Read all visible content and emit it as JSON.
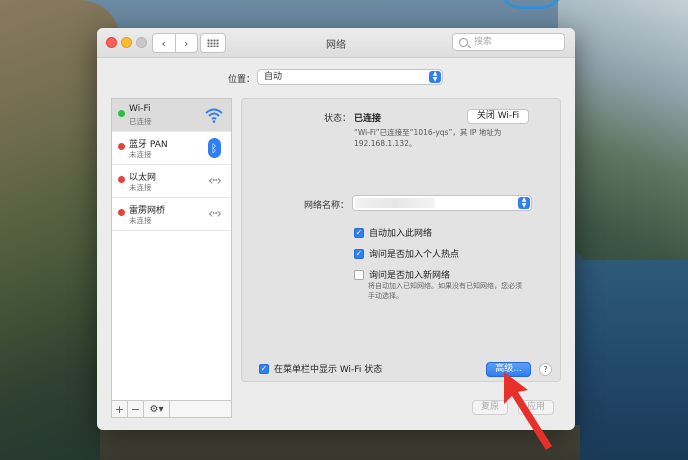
{
  "window": {
    "title": "网络",
    "search_placeholder": "搜索",
    "nav_back": "‹",
    "nav_forward": "›"
  },
  "location": {
    "label": "位置：",
    "value": "自动"
  },
  "sidebar": {
    "items": [
      {
        "name": "Wi-Fi",
        "status": "已连接",
        "dot_color": "#2fbf3f",
        "icon": "wifi-icon",
        "selected": true
      },
      {
        "name": "蓝牙 PAN",
        "status": "未连接",
        "dot_color": "#e0443a",
        "icon": "bluetooth-icon",
        "selected": false
      },
      {
        "name": "以太网",
        "status": "未连接",
        "dot_color": "#e0443a",
        "icon": "ethernet-icon",
        "selected": false
      },
      {
        "name": "雷雳网桥",
        "status": "未连接",
        "dot_color": "#e0443a",
        "icon": "ethernet-icon",
        "selected": false
      }
    ],
    "add_label": "+",
    "remove_label": "−",
    "gear_label": "⚙▾"
  },
  "panel": {
    "status_label": "状态：",
    "status_value": "已连接",
    "turn_off_label": "关闭 Wi-Fi",
    "status_desc": "“Wi-Fi”已连接至“1016-yqs”，其 IP 地址为 192.168.1.132。",
    "network_name_label": "网络名称：",
    "checkboxes": [
      {
        "label": "自动加入此网络",
        "checked": true
      },
      {
        "label": "询问是否加入个人热点",
        "checked": true
      },
      {
        "label": "询问是否加入新网络",
        "checked": false
      }
    ],
    "checkbox_desc": "将自动加入已知网络。如果没有已知网络，您必须手动选择。"
  },
  "footer": {
    "show_in_menubar_label": "在菜单栏中显示 Wi-Fi 状态",
    "show_in_menubar_checked": true,
    "advanced_label": "高级...",
    "help_label": "?",
    "revert_label": "复原",
    "apply_label": "应用"
  },
  "colors": {
    "accent": "#2f7ff0",
    "connected": "#2fbf3f",
    "disconnected": "#e0443a",
    "annotation_arrow": "#e8302a"
  }
}
